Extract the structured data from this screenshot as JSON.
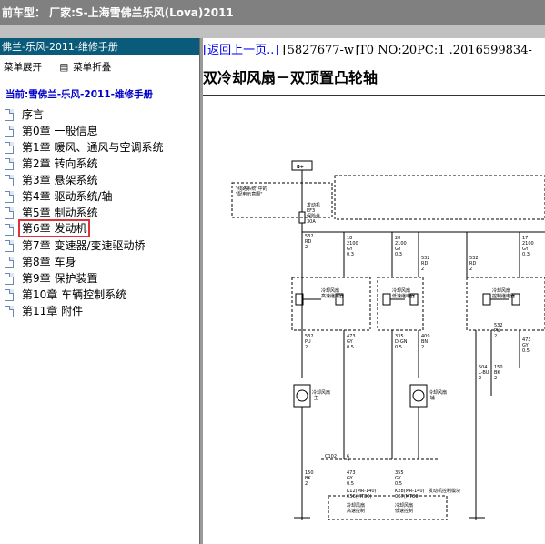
{
  "window": {
    "title": "前车型： 厂家:S-上海雪佛兰乐风(Lova)2011"
  },
  "sidebar": {
    "header": "佛兰-乐风-2011-维修手册",
    "expand_label": "菜单展开",
    "collapse_label": "菜单折叠",
    "collapse_icon": "menu-icon",
    "current_label": "当前:雪佛兰-乐风-2011-维修手册",
    "items": [
      {
        "label": "序言"
      },
      {
        "label": "第0章 一般信息"
      },
      {
        "label": "第1章 暖风、通风与空调系统"
      },
      {
        "label": "第2章 转向系统"
      },
      {
        "label": "第3章 悬架系统"
      },
      {
        "label": "第4章 驱动系统/轴"
      },
      {
        "label": "第5章 制动系统"
      },
      {
        "label": "第6章 发动机",
        "selected": true
      },
      {
        "label": "第7章 变速器/变速驱动桥"
      },
      {
        "label": "第8章 车身"
      },
      {
        "label": "第9章 保护装置"
      },
      {
        "label": "第10章 车辆控制系统"
      },
      {
        "label": "第11章 附件"
      }
    ],
    "selected_color": "#e0303a"
  },
  "content": {
    "back_link": "[返回上一页..]",
    "doc_meta": "[5827677-w]T0 NO:20PC:1 .2016599834-",
    "title": "双冷却风扇－双顶置凸轮轴"
  },
  "diagram": {
    "battery": "B+",
    "fusebox_note": [
      "\"线路系统\"中的",
      "\"配电示意图\""
    ],
    "fuse": [
      "发动机",
      "EF3",
      "保险丝",
      "30A"
    ],
    "fuse_wire": [
      "532",
      "RD",
      "2"
    ],
    "wire_top1": [
      "18",
      "2100",
      "GY",
      "0.3"
    ],
    "wire_top2": [
      "20",
      "2100",
      "GY",
      "0.3"
    ],
    "wire_top3": [
      "17",
      "2100",
      "GY",
      "0.3"
    ],
    "wire_532b": [
      "532",
      "RD",
      "2"
    ],
    "wire_532c": [
      "532",
      "RD",
      "2"
    ],
    "relay1": [
      "冷却风扇",
      "高速继电器"
    ],
    "relay2": [
      "冷却风扇",
      "低速继电器"
    ],
    "relay3": [
      "冷却风扇",
      "控制继电器"
    ],
    "pins": [
      "30",
      "85",
      "87",
      "86",
      "30",
      "85",
      "87",
      "86",
      "30",
      "86",
      "87A",
      "87"
    ],
    "wire_mid1": [
      "532",
      "PU",
      "2"
    ],
    "wire_mid2": [
      "473",
      "GY",
      "0.5"
    ],
    "wire_mid3": [
      "335",
      "D-GN",
      "0.5"
    ],
    "wire_mid4": [
      "409",
      "BN",
      "2"
    ],
    "wire_mid5": [
      "504",
      "L-BU",
      "2"
    ],
    "wire_mid6": [
      "150",
      "BK",
      "2"
    ],
    "wire_mid7": [
      "532",
      "PU",
      "2"
    ],
    "wire_mid8": [
      "473",
      "GY",
      "0.5"
    ],
    "fan_main": [
      "冷却风扇",
      "-主"
    ],
    "fan_aux": [
      "冷却风扇",
      "-辅"
    ],
    "connector": "C102",
    "conn_pins": [
      "6",
      "7"
    ],
    "wire_low1": [
      "150",
      "BK",
      "2"
    ],
    "wire_low2": [
      "473",
      "GY",
      "0.5"
    ],
    "wire_low3": [
      "355",
      "GY",
      "0.5"
    ],
    "k12": [
      "K12(MR-140)",
      "C56(MT80)"
    ],
    "k28": [
      "K28(MR-140)",
      "C67(MT80)"
    ],
    "ecm_label": "发动机控制模块",
    "ctrl1": [
      "冷却风扇",
      "高速控制"
    ],
    "ctrl2": [
      "冷却风扇",
      "低速控制"
    ],
    "grounds": [
      "G104",
      "G102"
    ]
  }
}
